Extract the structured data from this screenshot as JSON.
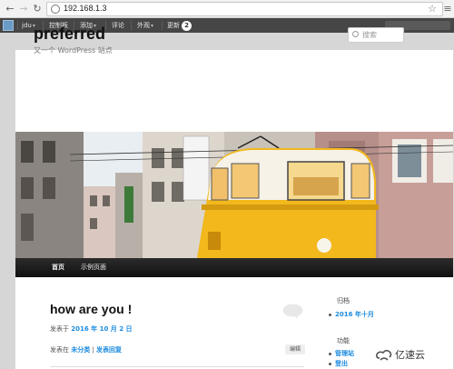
{
  "browser": {
    "url": "192.168.1.3"
  },
  "admin_bar": {
    "site": "jdu",
    "items": [
      "控制板",
      "添加",
      "评论",
      "外观",
      "更新"
    ],
    "update_count": "2"
  },
  "site": {
    "title": "preferred",
    "description": "又一个 WordPress 站点",
    "search_placeholder": "搜索"
  },
  "nav": {
    "items": [
      "首页",
      "示例页面"
    ]
  },
  "post": {
    "title": "how are you !",
    "meta_prefix": "发表于",
    "date": "2016 年 10 月 2 日",
    "footer_prefix": "发表在",
    "category": "未分类",
    "separator": " | ",
    "reply_link": "发表回复",
    "edit_label": "编辑"
  },
  "sidebar": {
    "archives_title": "归档",
    "archive_item": "2016 年十月",
    "meta_title": "功能",
    "meta_items": [
      "管理站",
      "登出"
    ]
  },
  "watermark": {
    "text": "亿速云"
  },
  "colors": {
    "admin_bar": "#464646",
    "link": "#1b8be0",
    "nav_bar": "#1a1a1a"
  }
}
